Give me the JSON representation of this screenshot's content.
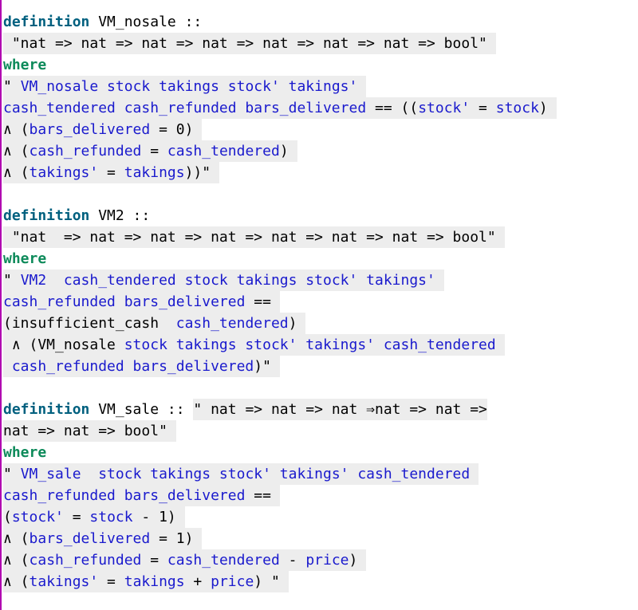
{
  "editor": {
    "border_color": "#b000b0",
    "colors": {
      "keyword": "#00607f",
      "where": "#0d8a5a",
      "variable": "#1a1acd",
      "plain": "#000000",
      "highlight": "#ededed"
    },
    "lines": [
      {
        "hl": false,
        "tokens": [
          {
            "t": "definition",
            "c": "kw"
          },
          {
            "t": " VM_nosale ::",
            "c": "txt"
          }
        ]
      },
      {
        "hl": true,
        "tokens": [
          {
            "t": " \"nat => nat => nat => nat => nat => nat => nat => bool\"",
            "c": "txt"
          }
        ]
      },
      {
        "hl": false,
        "tokens": [
          {
            "t": "where",
            "c": "kw2"
          }
        ]
      },
      {
        "hl": true,
        "tokens": [
          {
            "t": "\" ",
            "c": "txt"
          },
          {
            "t": "VM_nosale stock takings stock' takings'",
            "c": "var"
          }
        ]
      },
      {
        "hl": true,
        "tokens": [
          {
            "t": "cash_tendered cash_refunded bars_delivered",
            "c": "var"
          },
          {
            "t": " == ((",
            "c": "txt"
          },
          {
            "t": "stock'",
            "c": "var"
          },
          {
            "t": " = ",
            "c": "txt"
          },
          {
            "t": "stock",
            "c": "var"
          },
          {
            "t": ")",
            "c": "txt"
          }
        ]
      },
      {
        "hl": true,
        "tokens": [
          {
            "t": "∧ (",
            "c": "txt"
          },
          {
            "t": "bars_delivered",
            "c": "var"
          },
          {
            "t": " = 0)",
            "c": "txt"
          }
        ]
      },
      {
        "hl": true,
        "tokens": [
          {
            "t": "∧ (",
            "c": "txt"
          },
          {
            "t": "cash_refunded",
            "c": "var"
          },
          {
            "t": " = ",
            "c": "txt"
          },
          {
            "t": "cash_tendered",
            "c": "var"
          },
          {
            "t": ")",
            "c": "txt"
          }
        ]
      },
      {
        "hl": true,
        "tokens": [
          {
            "t": "∧ (",
            "c": "txt"
          },
          {
            "t": "takings'",
            "c": "var"
          },
          {
            "t": " = ",
            "c": "txt"
          },
          {
            "t": "takings",
            "c": "var"
          },
          {
            "t": "))\"",
            "c": "txt"
          }
        ]
      },
      {
        "hl": false,
        "tokens": []
      },
      {
        "hl": false,
        "tokens": [
          {
            "t": "definition",
            "c": "kw"
          },
          {
            "t": " VM2 ::",
            "c": "txt"
          }
        ]
      },
      {
        "hl": true,
        "tokens": [
          {
            "t": " \"nat  => nat => nat => nat => nat => nat => nat => bool\"",
            "c": "txt"
          }
        ]
      },
      {
        "hl": false,
        "tokens": [
          {
            "t": "where",
            "c": "kw2"
          }
        ]
      },
      {
        "hl": true,
        "tokens": [
          {
            "t": "\" ",
            "c": "txt"
          },
          {
            "t": "VM2  cash_tendered stock takings stock' takings'",
            "c": "var"
          }
        ]
      },
      {
        "hl": true,
        "tokens": [
          {
            "t": "cash_refunded bars_delivered",
            "c": "var"
          },
          {
            "t": " ==",
            "c": "txt"
          }
        ]
      },
      {
        "hl": true,
        "tokens": [
          {
            "t": "(insufficient_cash  ",
            "c": "txt"
          },
          {
            "t": "cash_tendered",
            "c": "var"
          },
          {
            "t": ")",
            "c": "txt"
          }
        ]
      },
      {
        "hl": true,
        "tokens": [
          {
            "t": " ∧ (VM_nosale ",
            "c": "txt"
          },
          {
            "t": "stock takings stock' takings' cash_tendered",
            "c": "var"
          }
        ]
      },
      {
        "hl": true,
        "tokens": [
          {
            "t": " cash_refunded bars_delivered",
            "c": "var"
          },
          {
            "t": ")\"",
            "c": "txt"
          }
        ]
      },
      {
        "hl": false,
        "tokens": []
      },
      {
        "hl": false,
        "tokens": [
          {
            "t": "definition",
            "c": "kw"
          },
          {
            "t": " VM_sale :: ",
            "c": "txt"
          },
          {
            "t": "\" nat => nat => nat ⇒nat => nat =>",
            "c": "txt",
            "hl": true
          }
        ]
      },
      {
        "hl": true,
        "tokens": [
          {
            "t": "nat => nat => bool\"",
            "c": "txt"
          }
        ]
      },
      {
        "hl": false,
        "tokens": [
          {
            "t": "where",
            "c": "kw2"
          }
        ]
      },
      {
        "hl": true,
        "tokens": [
          {
            "t": "\" ",
            "c": "txt"
          },
          {
            "t": "VM_sale  stock takings stock' takings' cash_tendered",
            "c": "var"
          }
        ]
      },
      {
        "hl": true,
        "tokens": [
          {
            "t": "cash_refunded bars_delivered",
            "c": "var"
          },
          {
            "t": " ==",
            "c": "txt"
          }
        ]
      },
      {
        "hl": true,
        "tokens": [
          {
            "t": "(",
            "c": "txt"
          },
          {
            "t": "stock'",
            "c": "var"
          },
          {
            "t": " = ",
            "c": "txt"
          },
          {
            "t": "stock",
            "c": "var"
          },
          {
            "t": " - 1)",
            "c": "txt"
          }
        ]
      },
      {
        "hl": true,
        "tokens": [
          {
            "t": "∧ (",
            "c": "txt"
          },
          {
            "t": "bars_delivered",
            "c": "var"
          },
          {
            "t": " = 1)",
            "c": "txt"
          }
        ]
      },
      {
        "hl": true,
        "tokens": [
          {
            "t": "∧ (",
            "c": "txt"
          },
          {
            "t": "cash_refunded",
            "c": "var"
          },
          {
            "t": " = ",
            "c": "txt"
          },
          {
            "t": "cash_tendered",
            "c": "var"
          },
          {
            "t": " - ",
            "c": "txt"
          },
          {
            "t": "price",
            "c": "var"
          },
          {
            "t": ")",
            "c": "txt"
          }
        ]
      },
      {
        "hl": true,
        "tokens": [
          {
            "t": "∧ (",
            "c": "txt"
          },
          {
            "t": "takings'",
            "c": "var"
          },
          {
            "t": " = ",
            "c": "txt"
          },
          {
            "t": "takings",
            "c": "var"
          },
          {
            "t": " + ",
            "c": "txt"
          },
          {
            "t": "price",
            "c": "var"
          },
          {
            "t": ") \"",
            "c": "txt"
          }
        ]
      }
    ]
  }
}
